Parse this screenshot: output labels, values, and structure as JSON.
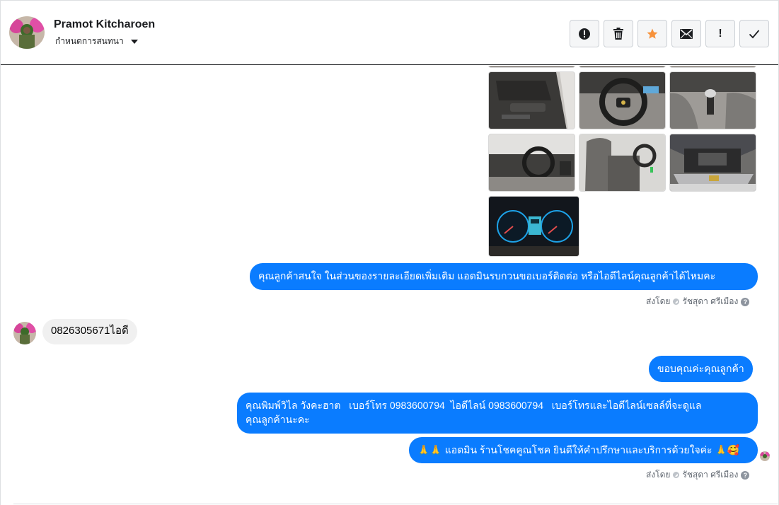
{
  "header": {
    "contact_name": "Pramot Kitcharoen",
    "assign_label": "กำหนดการสนทนา",
    "toolbar": [
      {
        "name": "spam-alert-button",
        "icon": "alert-circle-icon"
      },
      {
        "name": "delete-button",
        "icon": "trash-icon"
      },
      {
        "name": "star-button",
        "icon": "star-icon",
        "color": "#f7923b"
      },
      {
        "name": "mark-unread-button",
        "icon": "envelope-icon"
      },
      {
        "name": "follow-up-button",
        "icon": "exclamation-icon",
        "glyph": "!"
      },
      {
        "name": "mark-done-button",
        "icon": "checkmark-icon"
      }
    ]
  },
  "thread": {
    "photos": [
      {
        "name": "photo-door-interior"
      },
      {
        "name": "photo-steering-wheel"
      },
      {
        "name": "photo-gear-shift"
      },
      {
        "name": "photo-dashboard"
      },
      {
        "name": "photo-front-seats"
      },
      {
        "name": "photo-engine-bay"
      },
      {
        "name": "photo-instrument-cluster"
      }
    ],
    "msg_admin_ask": "คุณลูกค้าสนใจ ในส่วนของรายละเอียดเพิ่มเติม แอดมินรบกวนขอเบอร์ติดต่อ หรือไอดีไลน์คุณลูกค้าได้ไหมคะ",
    "sent_by_1": {
      "prefix": "ส่งโดย",
      "agent": "รัชสุดา ศรีเมือง",
      "help": "?"
    },
    "msg_customer": "0826305671ไอดี",
    "msg_thanks": "ขอบคุณค่ะคุณลูกค้า",
    "msg_contact_line1": "คุณพิมพ์วิไล วังคะฮาต   เบอร์โทร 0983600794  ไอดีไลน์ 0983600794   เบอร์โทรและไอดีไลน์เซลล์ที่จะดูแล",
    "msg_contact_line2": "คุณลูกค้านะคะ",
    "msg_closing": "แอดมิน ร้านโชคคูณโชค ยินดีให้คำปรึกษาและบริการด้วยใจค่ะ",
    "msg_closing_emoji_prefix": "🙏🙏",
    "msg_closing_emoji_suffix": "🙏🥰",
    "sent_by_2": {
      "prefix": "ส่งโดย",
      "agent": "รัชสุดา ศรีเมือง",
      "help": "?"
    }
  },
  "colors": {
    "outgoing_bubble": "#0a7cff",
    "incoming_bubble": "#f0f0f0",
    "star": "#f7923b"
  }
}
